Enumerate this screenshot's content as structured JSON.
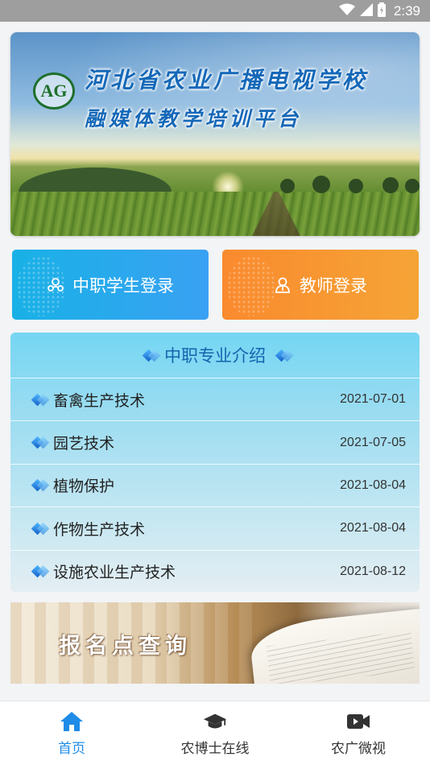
{
  "status_bar": {
    "time": "2:39",
    "icons": [
      "wifi-icon",
      "signal-icon",
      "battery-icon"
    ]
  },
  "hero": {
    "title": "河北省农业广播电视学校",
    "subtitle": "融媒体教学培训平台",
    "logo_text": "AG"
  },
  "login": {
    "student_label": "中职学生登录",
    "student_icon": "student-icon",
    "teacher_label": "教师登录",
    "teacher_icon": "teacher-icon",
    "student_color": "#29a9ee",
    "teacher_color": "#f7962f"
  },
  "majors": {
    "title": "中职专业介绍",
    "items": [
      {
        "name": "畜禽生产技术",
        "date": "2021-07-01"
      },
      {
        "name": "园艺技术",
        "date": "2021-07-05"
      },
      {
        "name": "植物保护",
        "date": "2021-08-04"
      },
      {
        "name": "作物生产技术",
        "date": "2021-08-04"
      },
      {
        "name": "设施农业生产技术",
        "date": "2021-08-12"
      }
    ]
  },
  "registration_banner": {
    "title": "报名点查询"
  },
  "tabbar": {
    "active_color": "#1f8ce8",
    "tabs": [
      {
        "label": "首页",
        "icon": "home-icon",
        "active": true
      },
      {
        "label": "农博士在线",
        "icon": "graduation-cap-icon",
        "active": false
      },
      {
        "label": "农广微视",
        "icon": "video-camera-icon",
        "active": false
      }
    ]
  }
}
